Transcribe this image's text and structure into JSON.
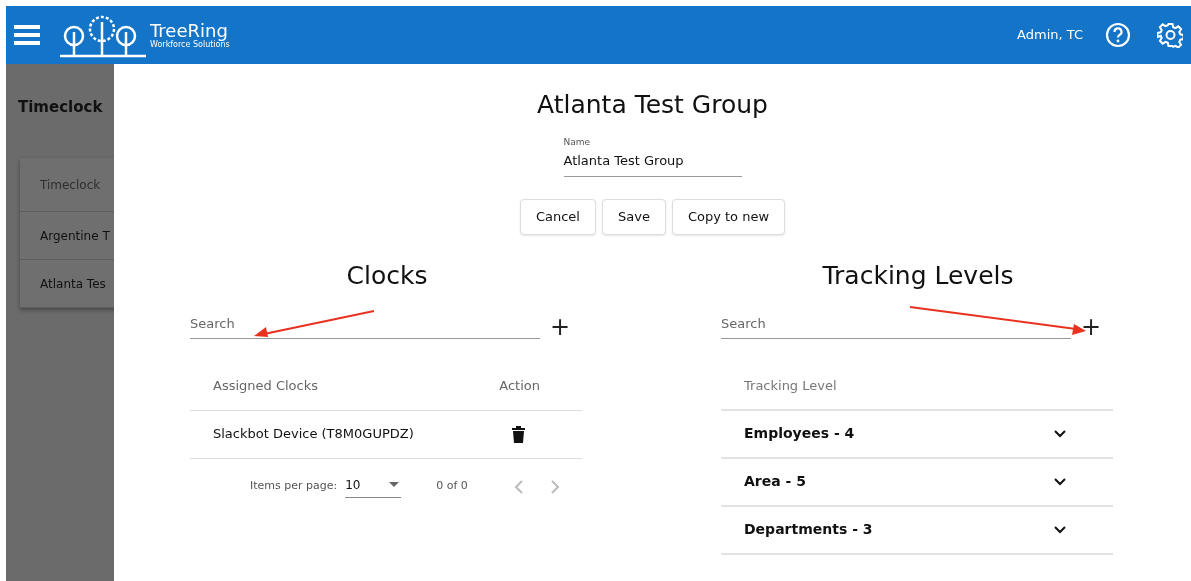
{
  "header": {
    "brand": "TreeRing",
    "tagline": "Workforce Solutions",
    "user": "Admin, TC"
  },
  "background_page": {
    "title": "Timeclock",
    "table_header": "Timeclock",
    "rows": [
      "Argentine T",
      "Atlanta Tes"
    ]
  },
  "dialog": {
    "title": "Atlanta Test Group",
    "name_field": {
      "label": "Name",
      "value": "Atlanta Test Group"
    },
    "buttons": [
      "Cancel",
      "Save",
      "Copy to new"
    ],
    "clocks": {
      "heading": "Clocks",
      "search": {
        "placeholder": "Search"
      },
      "add": "+",
      "columns": [
        "Assigned Clocks",
        "Action"
      ],
      "rows": [
        {
          "name": "Slackbot Device (T8M0GUPDZ)"
        }
      ],
      "paginator": {
        "label": "Items per page:",
        "page_size": "10",
        "range": "0 of 0"
      }
    },
    "tracking": {
      "heading": "Tracking Levels",
      "search": {
        "placeholder": "Search"
      },
      "add": "+",
      "column": "Tracking Level",
      "levels": [
        {
          "label": "Employees - 4",
          "expanded": false
        },
        {
          "label": "Area - 5",
          "expanded": false
        },
        {
          "label": "Departments - 3",
          "expanded": false
        }
      ]
    }
  }
}
